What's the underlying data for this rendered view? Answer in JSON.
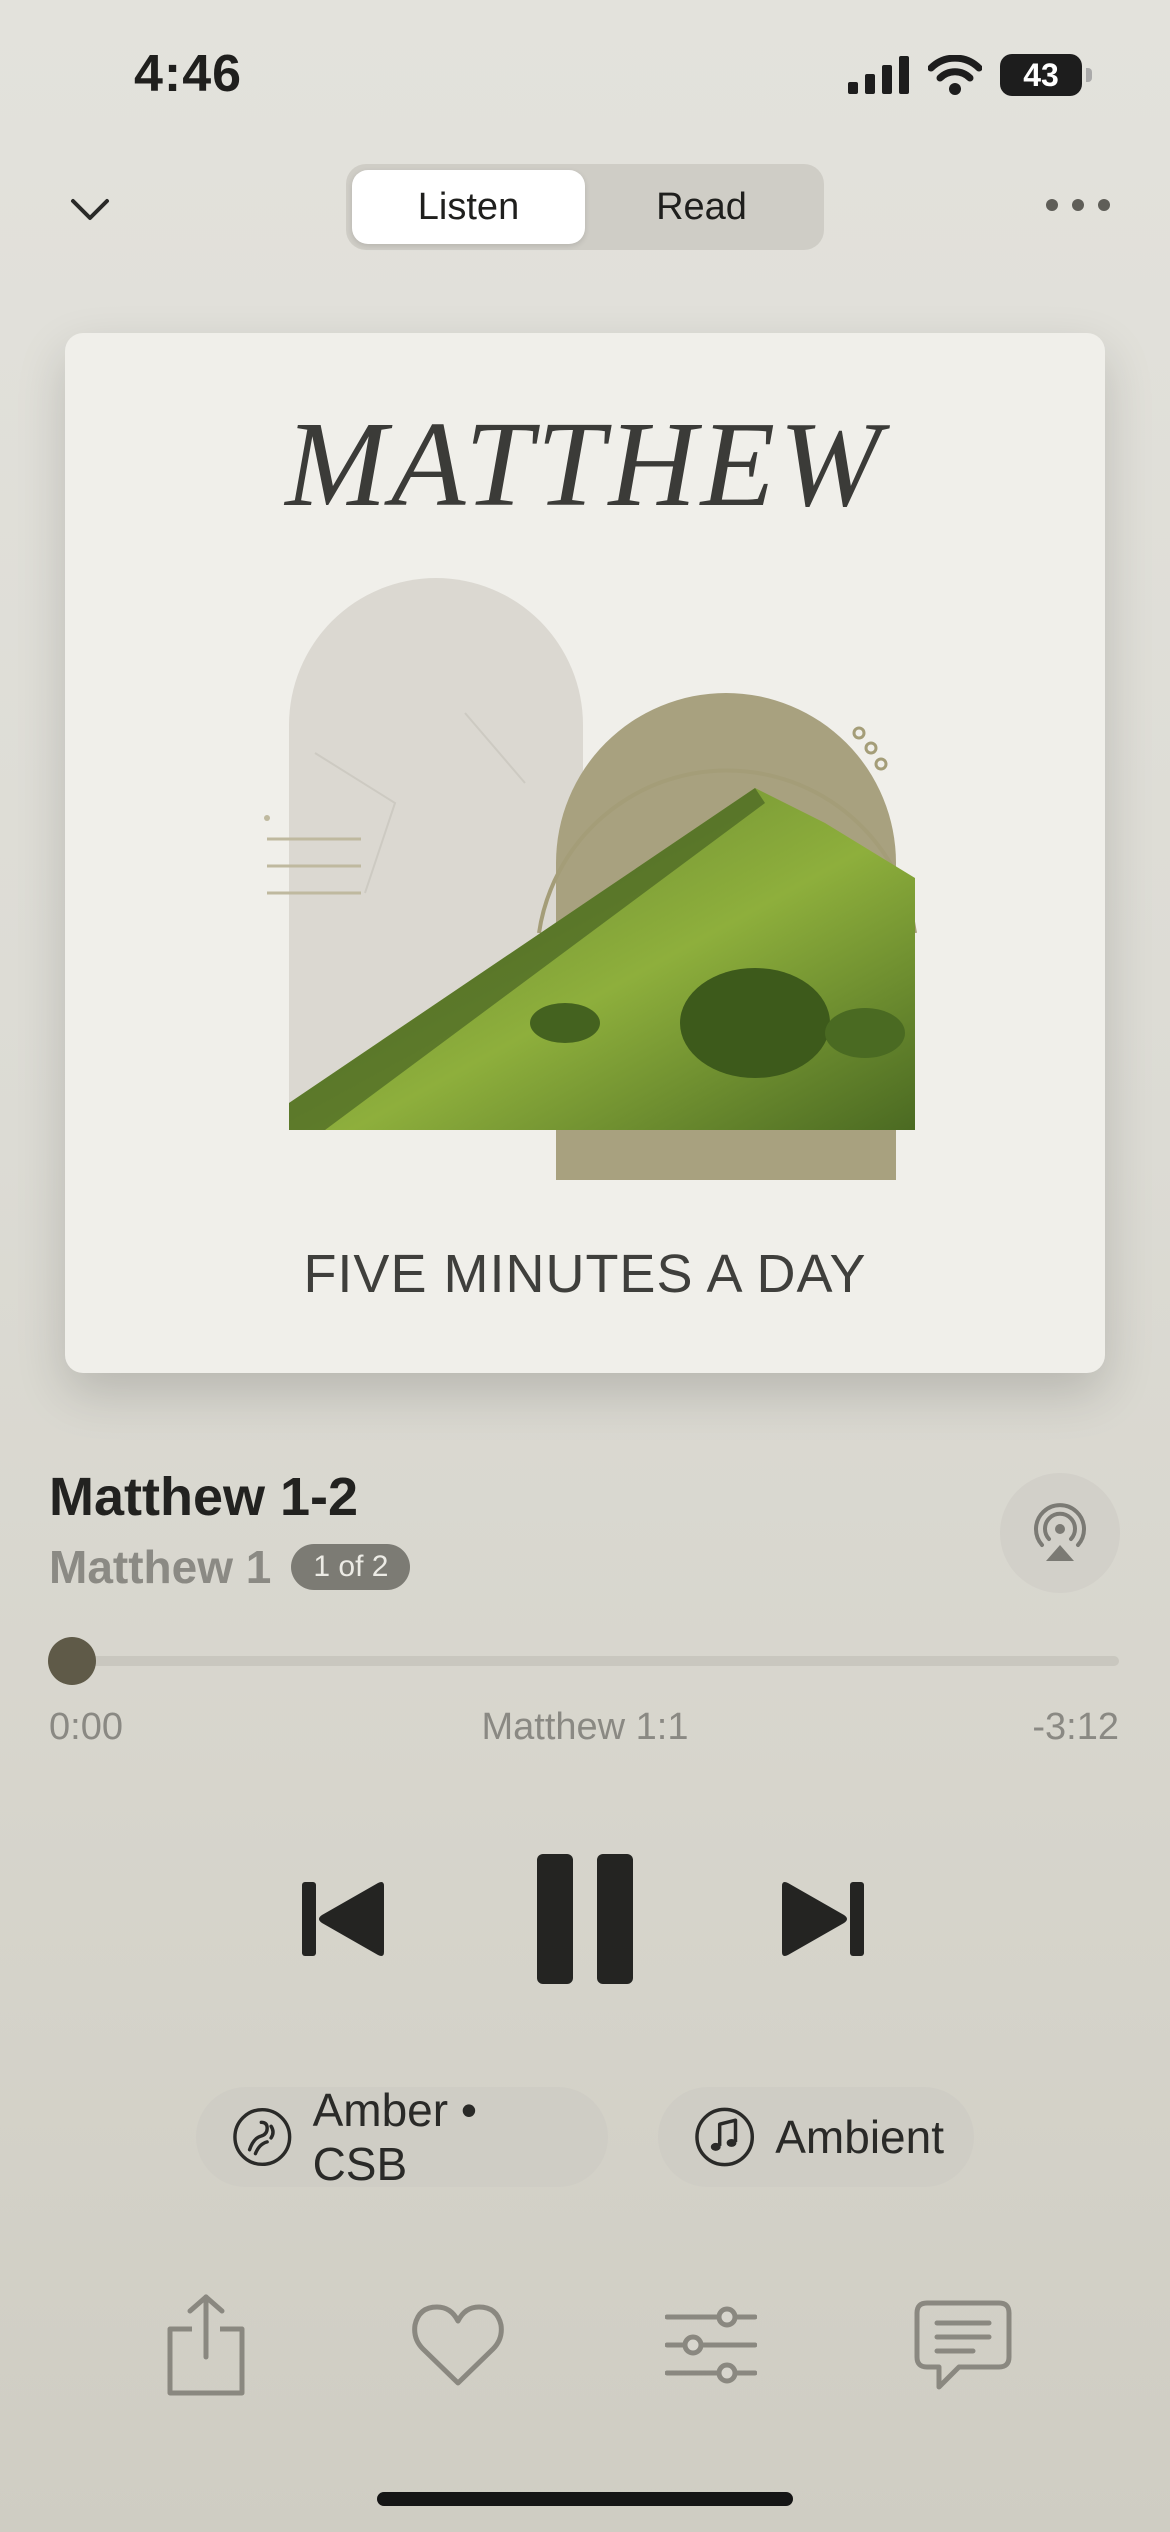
{
  "status_bar": {
    "time": "4:46",
    "battery": "43",
    "icons": [
      "signal-icon",
      "wifi-icon",
      "battery-icon"
    ]
  },
  "nav": {
    "collapse_icon": "chevron-down-icon",
    "tabs": [
      {
        "label": "Listen",
        "active": true
      },
      {
        "label": "Read",
        "active": false
      }
    ],
    "more_icon": "ellipsis-icon"
  },
  "artwork": {
    "title": "MATTHEW",
    "subtitle": "FIVE MINUTES A DAY"
  },
  "track": {
    "title": "Matthew 1-2",
    "subtitle": "Matthew 1",
    "part_badge": "1 of 2",
    "airplay_icon": "airplay-icon"
  },
  "progress": {
    "elapsed": "0:00",
    "current_verse": "Matthew 1:1",
    "remaining": "-3:12",
    "fraction": 0.0
  },
  "controls": {
    "previous_icon": "skip-back-icon",
    "pause_icon": "pause-icon",
    "next_icon": "skip-forward-icon"
  },
  "chips": {
    "voice": {
      "icon": "voice-icon",
      "label": "Amber • CSB"
    },
    "ambient": {
      "icon": "music-note-icon",
      "label": "Ambient"
    }
  },
  "toolbar": {
    "icons": [
      "share-icon",
      "heart-icon",
      "sliders-icon",
      "comment-icon"
    ]
  },
  "colors": {
    "accent": "#5f5a48",
    "background": "#dcdbd4",
    "card": "#f0efea"
  }
}
